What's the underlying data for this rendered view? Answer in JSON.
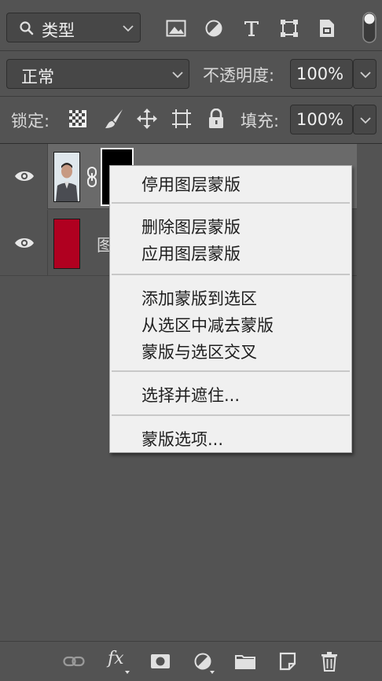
{
  "filter": {
    "kind_label": "类型",
    "icons": [
      "image-filter-icon",
      "adjustment-filter-icon",
      "type-filter-icon",
      "shape-filter-icon",
      "smart-object-filter-icon"
    ]
  },
  "blend": {
    "mode": "正常",
    "opacity_label": "不透明度:",
    "opacity_value": "100%"
  },
  "lock": {
    "label": "锁定:",
    "fill_label": "填充:",
    "fill_value": "100%"
  },
  "layers": [
    {
      "name": "",
      "visible": true,
      "has_mask": true
    },
    {
      "name": "图",
      "visible": true,
      "color": "#b00020"
    }
  ],
  "context_menu": {
    "groups": [
      [
        "停用图层蒙版"
      ],
      [
        "删除图层蒙版",
        "应用图层蒙版"
      ],
      [
        "添加蒙版到选区",
        "从选区中减去蒙版",
        "蒙版与选区交叉"
      ],
      [
        "选择并遮住..."
      ],
      [
        "蒙版选项..."
      ]
    ]
  },
  "bottom_toolbar": {
    "fx_label": "fx",
    "icons": [
      "link-layers-icon",
      "fx-icon",
      "add-mask-icon",
      "adjustment-layer-icon",
      "group-folder-icon",
      "new-layer-icon",
      "delete-layer-icon"
    ]
  }
}
